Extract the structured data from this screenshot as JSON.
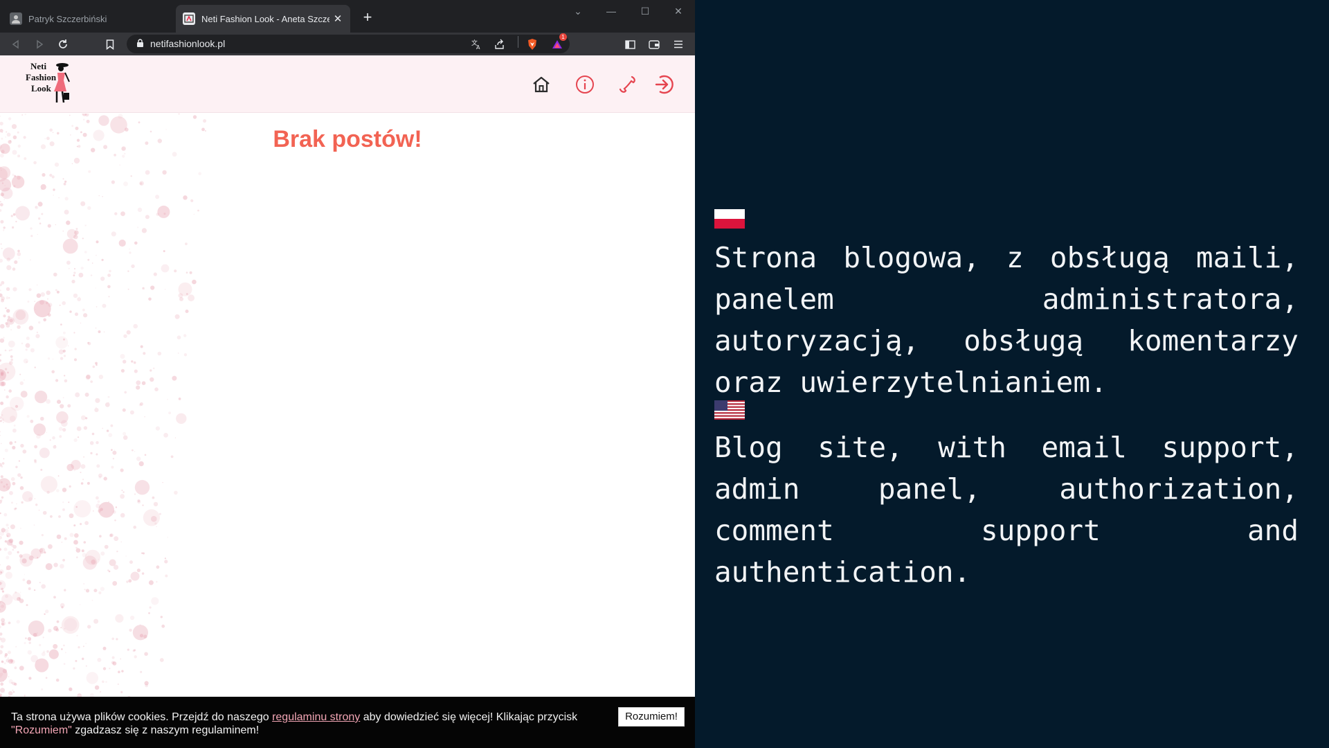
{
  "browser": {
    "tabs": [
      {
        "title": "Patryk Szczerbiński",
        "favicon": "user-avatar-icon",
        "active": false
      },
      {
        "title": "Neti Fashion Look - Aneta Szczerbińska",
        "favicon": "site-favicon-icon",
        "active": true
      }
    ],
    "url": "netifashionlook.pl",
    "notification_count": "1",
    "colors": {
      "tabstrip": "#202124",
      "toolbar": "#35363a",
      "brave_orange": "#f15a24"
    }
  },
  "site": {
    "logo": {
      "line1": "Neti",
      "line2": "Fashion",
      "line3": "Look"
    },
    "nav": [
      "home-icon",
      "info-icon",
      "phone-icon",
      "login-icon"
    ],
    "empty_message": "Brak postów!",
    "accent_color": "#f26353",
    "header_bg": "#fdf1f4"
  },
  "cookie": {
    "text_before": "Ta strona używa plików cookies. Przejdź do naszego ",
    "link": "regulaminu strony",
    "text_middle": " aby dowiedzieć się więcej! Klikając przycisk ",
    "quoted": "\"Rozumiem\"",
    "text_after": " zgadzasz się z naszym regulaminem!",
    "button": "Rozumiem!"
  },
  "description": {
    "pl": "Strona blogowa, z obsługą maili, panelem administratora, autoryzacją, obsługą komentarzy oraz uwierzytelnianiem.",
    "en": "Blog site, with email support, admin panel, authorization, comment support and authentication."
  },
  "background_color": "#041a2b"
}
